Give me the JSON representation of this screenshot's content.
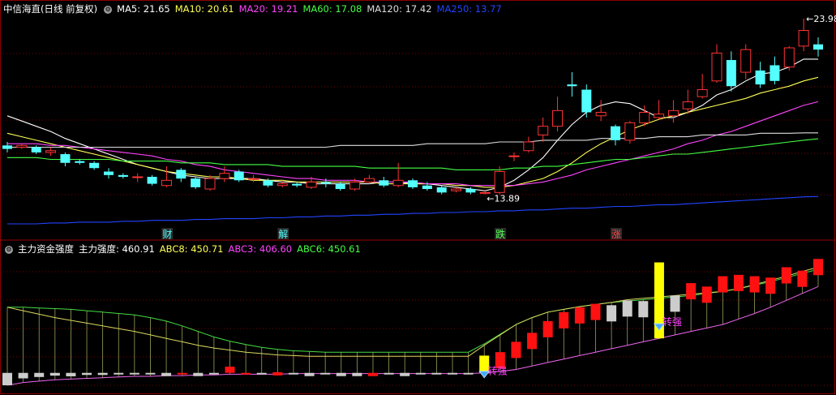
{
  "header": {
    "title": "中信海直(日线 前复权)",
    "ma": [
      {
        "label": "MA5: 21.65",
        "color": "#ffffff"
      },
      {
        "label": "MA10: 20.61",
        "color": "#ffff55"
      },
      {
        "label": "MA20: 19.21",
        "color": "#ff44ff"
      },
      {
        "label": "MA60: 17.08",
        "color": "#44ff44"
      },
      {
        "label": "MA120: 17.42",
        "color": "#dddddd"
      },
      {
        "label": "MA250: 13.77",
        "color": "#2244ff"
      }
    ]
  },
  "indicator_header": {
    "title": "主力资金强度",
    "items": [
      {
        "label": "主力强度: 460.91",
        "color": "#ffffff"
      },
      {
        "label": "ABC8: 450.71",
        "color": "#ffff55"
      },
      {
        "label": "ABC3: 406.60",
        "color": "#ff44ff"
      },
      {
        "label": "ABC6: 450.61",
        "color": "#44ff44"
      }
    ]
  },
  "colors": {
    "up": "#ff3333",
    "down": "#54ffff",
    "grid": "#7a0000",
    "bg": "#000000"
  },
  "chart_data": [
    {
      "type": "candlestick",
      "title": "中信海直(日线 前复权)",
      "annotations": [
        {
          "text": "23.98",
          "kind": "high"
        },
        {
          "text": "13.89",
          "kind": "low"
        }
      ],
      "markers": [
        {
          "text": "财",
          "color": "#54ffff",
          "bg": "#2a2a2a"
        },
        {
          "text": "解",
          "color": "#54ffff",
          "bg": "#2a2a2a"
        },
        {
          "text": "跌",
          "color": "#54ff54",
          "bg": "#2a2a2a"
        },
        {
          "text": "涨",
          "color": "#ff4444",
          "bg": "#2a2a2a"
        }
      ],
      "candles": [
        [
          16.7,
          16.5,
          16.9,
          16.3
        ],
        [
          16.6,
          16.7,
          16.8,
          16.5
        ],
        [
          16.6,
          16.3,
          16.7,
          16.2
        ],
        [
          16.3,
          16.4,
          16.6,
          16.1
        ],
        [
          16.2,
          15.7,
          16.3,
          15.5
        ],
        [
          15.8,
          15.7,
          15.9,
          15.6
        ],
        [
          15.7,
          15.4,
          15.8,
          15.3
        ],
        [
          15.2,
          15.0,
          15.4,
          14.8
        ],
        [
          15.0,
          14.9,
          15.1,
          14.8
        ],
        [
          14.9,
          14.9,
          15.1,
          14.6
        ],
        [
          14.9,
          14.5,
          15.0,
          14.4
        ],
        [
          14.4,
          14.7,
          15.5,
          14.3
        ],
        [
          15.3,
          14.8,
          15.4,
          14.6
        ],
        [
          14.8,
          14.3,
          14.9,
          14.2
        ],
        [
          14.2,
          14.8,
          15.0,
          14.1
        ],
        [
          14.8,
          15.1,
          15.5,
          14.6
        ],
        [
          15.2,
          14.7,
          15.3,
          14.6
        ],
        [
          14.8,
          14.8,
          15.0,
          14.6
        ],
        [
          14.7,
          14.4,
          14.8,
          14.3
        ],
        [
          14.4,
          14.5,
          14.6,
          14.3
        ],
        [
          14.5,
          14.4,
          14.6,
          14.3
        ],
        [
          14.3,
          14.6,
          14.9,
          14.2
        ],
        [
          14.6,
          14.5,
          14.8,
          14.3
        ],
        [
          14.5,
          14.2,
          14.6,
          14.1
        ],
        [
          14.2,
          14.6,
          14.8,
          14.1
        ],
        [
          14.6,
          14.8,
          15.0,
          14.5
        ],
        [
          14.7,
          14.4,
          14.9,
          14.3
        ],
        [
          14.4,
          14.7,
          15.7,
          14.3
        ],
        [
          14.7,
          14.3,
          14.8,
          14.2
        ],
        [
          14.4,
          14.2,
          14.6,
          14.1
        ],
        [
          14.3,
          14.0,
          14.4,
          13.9
        ],
        [
          14.1,
          14.2,
          14.3,
          14.0
        ],
        [
          14.2,
          14.0,
          14.3,
          13.9
        ],
        [
          14.0,
          14.0,
          14.1,
          13.89
        ],
        [
          14.0,
          15.2,
          15.5,
          13.9
        ],
        [
          16.1,
          16.1,
          16.3,
          15.8
        ],
        [
          16.4,
          16.9,
          17.2,
          16.3
        ],
        [
          17.3,
          17.8,
          18.3,
          16.9
        ],
        [
          17.8,
          18.7,
          19.5,
          17.5
        ],
        [
          20.2,
          20.1,
          20.9,
          19.5
        ],
        [
          19.9,
          18.6,
          20.2,
          18.3
        ],
        [
          18.4,
          18.6,
          19.3,
          18.1
        ],
        [
          17.8,
          17.0,
          17.9,
          16.7
        ],
        [
          17.0,
          18.0,
          18.1,
          16.8
        ],
        [
          18.0,
          18.6,
          19.0,
          17.8
        ],
        [
          18.3,
          18.5,
          19.3,
          18.2
        ],
        [
          18.4,
          18.7,
          19.3,
          18.0
        ],
        [
          18.8,
          19.2,
          19.9,
          18.5
        ],
        [
          19.5,
          19.9,
          20.8,
          19.4
        ],
        [
          20.4,
          22.0,
          22.5,
          20.3
        ],
        [
          21.6,
          20.1,
          22.1,
          19.8
        ],
        [
          20.9,
          22.2,
          22.5,
          20.5
        ],
        [
          21.0,
          20.2,
          21.5,
          20.0
        ],
        [
          21.3,
          20.4,
          21.8,
          20.2
        ],
        [
          21.2,
          22.3,
          22.4,
          21.0
        ],
        [
          22.4,
          23.3,
          23.98,
          22.1
        ],
        [
          22.5,
          22.2,
          22.9,
          21.8
        ]
      ],
      "ma_lines": [
        {
          "name": "MA5",
          "color": "#ffffff",
          "values": [
            18.4,
            18.1,
            17.8,
            17.5,
            17.1,
            16.8,
            16.5,
            16.2,
            15.9,
            15.6,
            15.4,
            15.2,
            15.0,
            14.9,
            14.8,
            14.8,
            14.8,
            14.8,
            14.7,
            14.6,
            14.6,
            14.5,
            14.5,
            14.5,
            14.5,
            14.5,
            14.6,
            14.6,
            14.5,
            14.5,
            14.4,
            14.3,
            14.2,
            14.1,
            14.3,
            14.7,
            15.3,
            16.0,
            17.0,
            17.9,
            18.6,
            19.0,
            19.2,
            19.1,
            18.7,
            18.3,
            18.3,
            18.6,
            19.0,
            19.6,
            19.9,
            20.4,
            20.8,
            20.9,
            21.2,
            21.65,
            21.65
          ]
        },
        {
          "name": "MA10",
          "color": "#ffff55",
          "values": [
            17.4,
            17.2,
            17.0,
            16.8,
            16.6,
            16.4,
            16.2,
            16.0,
            15.8,
            15.6,
            15.4,
            15.2,
            15.1,
            15.0,
            14.9,
            14.9,
            14.8,
            14.7,
            14.7,
            14.7,
            14.6,
            14.6,
            14.6,
            14.6,
            14.6,
            14.6,
            14.5,
            14.5,
            14.5,
            14.5,
            14.5,
            14.4,
            14.4,
            14.3,
            14.3,
            14.4,
            14.6,
            14.8,
            15.2,
            15.7,
            16.3,
            16.8,
            17.2,
            17.6,
            17.9,
            18.2,
            18.4,
            18.6,
            18.8,
            19.0,
            19.2,
            19.4,
            19.7,
            19.9,
            20.1,
            20.4,
            20.61
          ]
        },
        {
          "name": "MA20",
          "color": "#ff44ff",
          "values": [
            16.8,
            16.8,
            16.8,
            16.7,
            16.7,
            16.6,
            16.5,
            16.4,
            16.3,
            16.2,
            16.1,
            15.9,
            15.8,
            15.6,
            15.5,
            15.3,
            15.2,
            15.1,
            15.0,
            14.9,
            14.8,
            14.8,
            14.7,
            14.7,
            14.7,
            14.6,
            14.6,
            14.6,
            14.6,
            14.5,
            14.5,
            14.5,
            14.4,
            14.4,
            14.4,
            14.4,
            14.5,
            14.6,
            14.8,
            15.0,
            15.3,
            15.5,
            15.7,
            15.9,
            16.1,
            16.3,
            16.5,
            16.8,
            17.0,
            17.3,
            17.5,
            17.8,
            18.1,
            18.4,
            18.7,
            19.0,
            19.21
          ]
        },
        {
          "name": "MA60",
          "color": "#44ff44",
          "values": [
            16.0,
            16.0,
            16.0,
            15.9,
            15.9,
            15.9,
            15.9,
            15.9,
            15.8,
            15.8,
            15.8,
            15.8,
            15.7,
            15.7,
            15.7,
            15.6,
            15.6,
            15.6,
            15.6,
            15.5,
            15.5,
            15.5,
            15.5,
            15.5,
            15.5,
            15.4,
            15.4,
            15.4,
            15.4,
            15.4,
            15.4,
            15.3,
            15.3,
            15.3,
            15.3,
            15.4,
            15.4,
            15.5,
            15.5,
            15.6,
            15.7,
            15.8,
            15.9,
            15.9,
            16.0,
            16.1,
            16.2,
            16.2,
            16.3,
            16.4,
            16.5,
            16.6,
            16.7,
            16.8,
            16.9,
            17.0,
            17.08
          ]
        },
        {
          "name": "MA120",
          "color": "#dddddd",
          "values": [
            16.6,
            16.6,
            16.6,
            16.6,
            16.6,
            16.6,
            16.6,
            16.6,
            16.6,
            16.6,
            16.6,
            16.6,
            16.6,
            16.6,
            16.6,
            16.6,
            16.6,
            16.6,
            16.6,
            16.6,
            16.6,
            16.6,
            16.6,
            16.7,
            16.7,
            16.7,
            16.7,
            16.7,
            16.7,
            16.8,
            16.8,
            16.8,
            16.8,
            16.8,
            16.9,
            16.9,
            16.9,
            17.0,
            17.0,
            17.0,
            17.0,
            17.1,
            17.1,
            17.1,
            17.1,
            17.2,
            17.2,
            17.2,
            17.3,
            17.3,
            17.3,
            17.3,
            17.4,
            17.4,
            17.4,
            17.42,
            17.42
          ]
        },
        {
          "name": "MA250",
          "color": "#2244ff",
          "values": [
            12.2,
            12.2,
            12.2,
            12.25,
            12.25,
            12.3,
            12.3,
            12.3,
            12.35,
            12.35,
            12.4,
            12.4,
            12.4,
            12.45,
            12.45,
            12.5,
            12.5,
            12.5,
            12.55,
            12.55,
            12.6,
            12.6,
            12.65,
            12.65,
            12.7,
            12.7,
            12.75,
            12.75,
            12.8,
            12.8,
            12.85,
            12.85,
            12.9,
            12.9,
            12.95,
            12.95,
            13.0,
            13.0,
            13.05,
            13.1,
            13.1,
            13.15,
            13.2,
            13.2,
            13.25,
            13.3,
            13.3,
            13.35,
            13.4,
            13.45,
            13.5,
            13.55,
            13.6,
            13.65,
            13.7,
            13.75,
            13.77
          ]
        }
      ]
    },
    {
      "type": "bar",
      "title": "主力资金强度",
      "annotations": [
        {
          "text": "转强"
        },
        {
          "text": "转强"
        }
      ],
      "signal_index": [
        30,
        41
      ],
      "bars": [
        [
          0,
          -18,
          "g"
        ],
        [
          1,
          -8,
          "g"
        ],
        [
          2,
          -6,
          "g"
        ],
        [
          3,
          -4,
          "g"
        ],
        [
          4,
          -5,
          "g"
        ],
        [
          5,
          -3,
          "g"
        ],
        [
          6,
          -3,
          "g"
        ],
        [
          7,
          -2,
          "g"
        ],
        [
          8,
          -2,
          "g"
        ],
        [
          9,
          -1,
          "g"
        ],
        [
          10,
          0,
          "g"
        ],
        [
          11,
          -1,
          "r"
        ],
        [
          12,
          0,
          "g"
        ],
        [
          13,
          -1,
          "g"
        ],
        [
          14,
          9,
          "r"
        ],
        [
          15,
          -1,
          "r"
        ],
        [
          16,
          -1,
          "g"
        ],
        [
          17,
          1,
          "r"
        ],
        [
          18,
          -1,
          "g"
        ],
        [
          19,
          0,
          "g"
        ],
        [
          20,
          -1,
          "g"
        ],
        [
          21,
          0,
          "g"
        ],
        [
          22,
          0,
          "g"
        ],
        [
          23,
          0,
          "r"
        ],
        [
          24,
          -1,
          "g"
        ],
        [
          25,
          0,
          "g"
        ],
        [
          26,
          -1,
          "g"
        ],
        [
          27,
          -1,
          "g"
        ],
        [
          28,
          -1,
          "g"
        ],
        [
          29,
          -1,
          "g"
        ],
        [
          30,
          25,
          "y"
        ],
        [
          31,
          30,
          "r"
        ],
        [
          32,
          45,
          "r"
        ],
        [
          33,
          58,
          "r"
        ],
        [
          34,
          75,
          "r"
        ],
        [
          35,
          88,
          "r"
        ],
        [
          36,
          95,
          "r"
        ],
        [
          37,
          100,
          "r"
        ],
        [
          38,
          98,
          "g"
        ],
        [
          39,
          105,
          "g"
        ],
        [
          40,
          104,
          "g"
        ],
        [
          41,
          110,
          "y"
        ],
        [
          42,
          112,
          "g"
        ],
        [
          43,
          130,
          "r"
        ],
        [
          44,
          125,
          "r"
        ],
        [
          45,
          140,
          "r"
        ],
        [
          46,
          142,
          "r"
        ],
        [
          47,
          140,
          "r"
        ],
        [
          48,
          138,
          "r"
        ],
        [
          49,
          153,
          "r"
        ],
        [
          50,
          148,
          "r"
        ],
        [
          51,
          165,
          "r"
        ]
      ],
      "abc8": [
        95,
        90,
        85,
        80,
        76,
        72,
        68,
        64,
        60,
        55,
        50,
        45,
        40,
        36,
        33,
        30,
        28,
        26,
        25,
        24,
        24,
        24,
        24,
        24,
        24,
        24,
        24,
        24,
        24,
        24,
        40,
        55,
        70,
        80,
        88,
        92,
        96,
        99,
        102,
        106,
        108,
        110,
        112,
        114,
        116,
        118,
        122,
        128,
        134,
        140,
        147,
        153
      ],
      "abc3": [
        -18,
        -14,
        -12,
        -10,
        -9,
        -8,
        -7,
        -6,
        -5,
        -5,
        -4,
        -4,
        -3,
        -3,
        -2,
        -2,
        -2,
        -2,
        -1,
        -1,
        -1,
        -1,
        -1,
        -1,
        -1,
        -1,
        -1,
        -1,
        -1,
        -1,
        0,
        2,
        5,
        10,
        15,
        20,
        25,
        30,
        35,
        40,
        45,
        50,
        55,
        60,
        65,
        70,
        78,
        86,
        95,
        105,
        115,
        125
      ],
      "abc6": [
        95,
        95,
        94,
        93,
        92,
        90,
        88,
        86,
        84,
        80,
        75,
        68,
        60,
        52,
        46,
        41,
        37,
        34,
        32,
        31,
        30,
        30,
        30,
        30,
        30,
        30,
        30,
        30,
        30,
        30,
        42,
        56,
        70,
        80,
        88,
        92,
        96,
        99,
        102,
        104,
        106,
        108,
        110,
        112,
        115,
        118,
        122,
        127,
        132,
        138,
        144,
        150
      ]
    }
  ]
}
